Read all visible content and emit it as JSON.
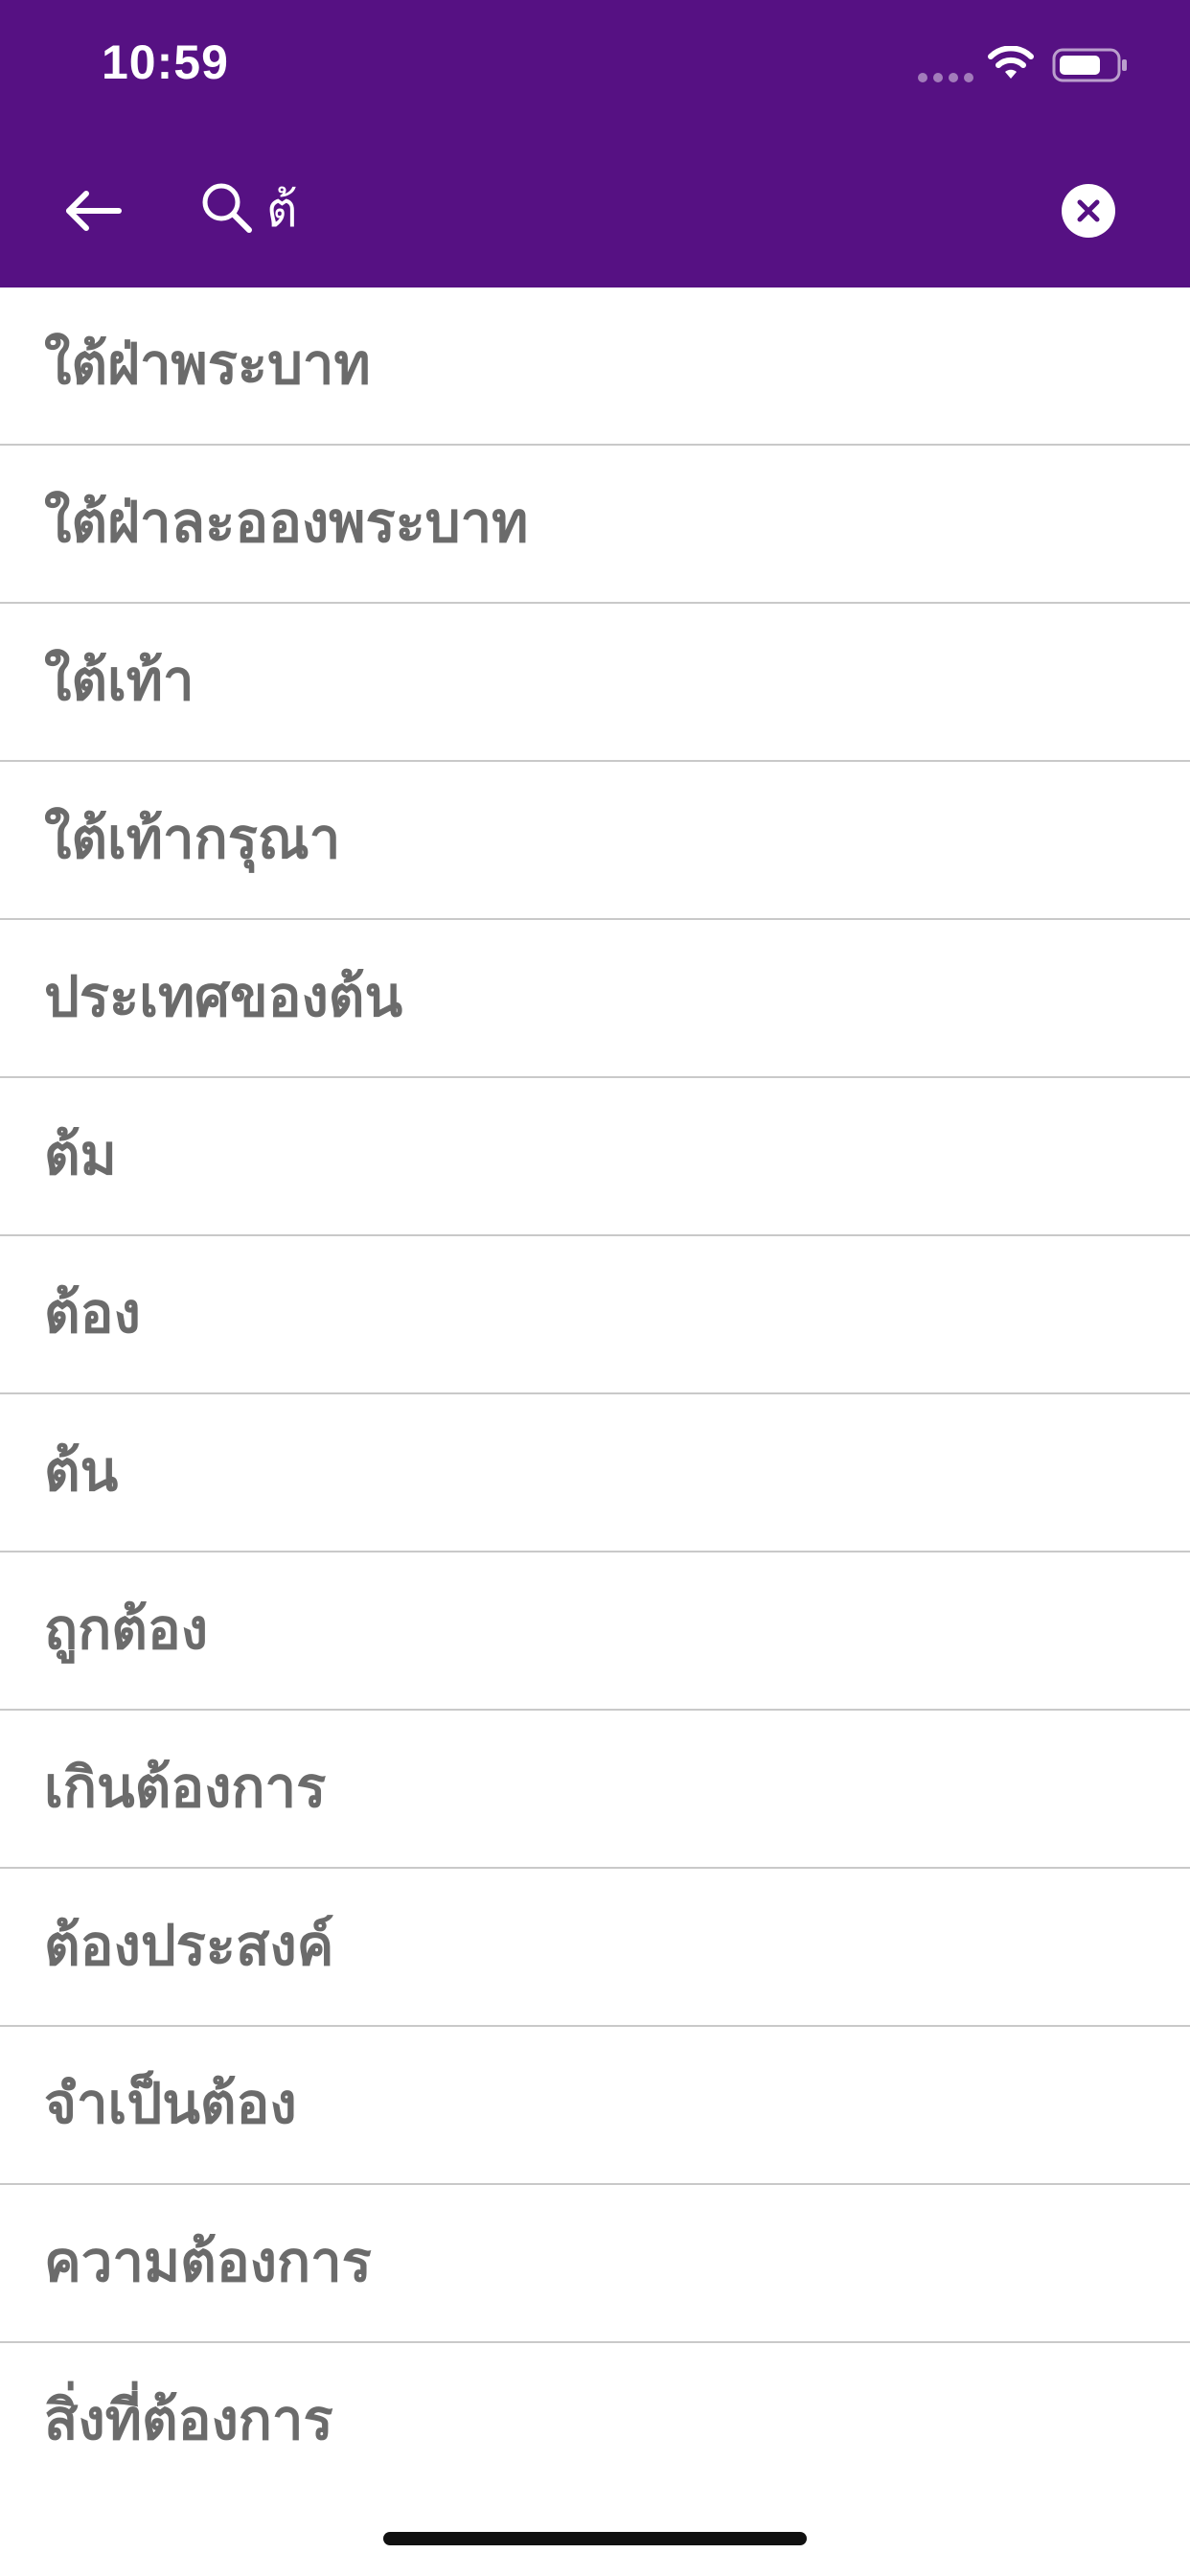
{
  "colors": {
    "header_bg": "#561183",
    "header_fg": "#ffffff",
    "item_text": "#6b6b6b",
    "divider": "#c9c9c9",
    "background": "#ffffff"
  },
  "status_bar": {
    "time": "10:59",
    "icons": [
      "signal-dots-icon",
      "wifi-icon",
      "battery-icon"
    ]
  },
  "search": {
    "back_icon": "arrow-left-icon",
    "search_icon": "search-icon",
    "query": "ต้",
    "clear_icon": "clear-circle-x-icon"
  },
  "results": [
    "ใต้ฝ่าพระบาท",
    "ใต้ฝ่าละอองพระบาท",
    "ใต้เท้า",
    "ใต้เท้ากรุณา",
    "ประเทศของต้น",
    "ต้ม",
    "ต้อง",
    "ต้น",
    "ถูกต้อง",
    "เกินต้องการ",
    "ต้องประสงค์",
    "จำเป็นต้อง",
    "ความต้องการ",
    "สิ่งที่ต้องการ"
  ]
}
